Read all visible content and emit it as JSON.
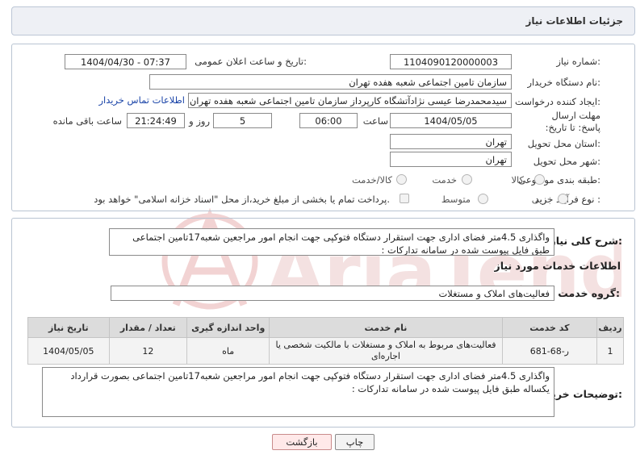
{
  "header": {
    "title": "جزئیات اطلاعات نیاز"
  },
  "form": {
    "need_number_label": "شماره نیاز:",
    "need_number": "1104090120000003",
    "announce_label": "تاریخ و ساعت اعلان عمومی:",
    "announce_value": "1404/04/30 - 07:37",
    "buyer_org_label": "نام دستگاه خریدار:",
    "buyer_org": "سازمان تامین اجتماعی شعبه هفده تهران",
    "creator_label": "ایجاد کننده درخواست:",
    "creator": "سیدمحمدرضا عیسی نژادآتشگاه کارپرداز سازمان تامین اجتماعی شعبه هفده تهران",
    "contact_link": "اطلاعات تماس خریدار",
    "deadline_label": "مهلت ارسال پاسخ: تا تاریخ:",
    "deadline_date": "1404/05/05",
    "hour_label": "ساعت",
    "deadline_time": "06:00",
    "days_value": "5",
    "days_label": "روز و",
    "remaining_time": "21:24:49",
    "remaining_label": "ساعت باقی مانده",
    "province_label": "استان محل تحویل:",
    "province": "تهران",
    "city_label": "شهر محل تحویل:",
    "city": "تهران",
    "category_label": "طبقه بندی موضوعی:",
    "category_options": [
      "کالا",
      "خدمت",
      "کالا/خدمت"
    ],
    "process_label": "نوع فرآیند خرید :",
    "process_options": [
      "جزیی",
      "متوسط"
    ],
    "payment_note": "پرداخت تمام یا بخشی از مبلغ خرید،از محل \"اسناد خزانه اسلامی\" خواهد بود."
  },
  "details": {
    "summary_label": "شرح کلی نیاز:",
    "summary_text": "واگذاری 4.5متر فضای اداری جهت استقرار دستگاه فتوکپی جهت انجام امور مراجعین شعبه17تامین اجتماعی طبق فایل پیوست شده در سامانه تدارکات :",
    "services_title": "اطلاعات خدمات مورد نیاز",
    "service_group_label": "گروه خدمت:",
    "service_group": "فعالیت‌های  املاک و مستغلات",
    "table": {
      "headers": [
        "ردیف",
        "کد خدمت",
        "نام خدمت",
        "واحد اندازه گیری",
        "تعداد / مقدار",
        "تاریخ نیاز"
      ],
      "rows": [
        [
          "1",
          "ر-68-681",
          "فعالیت‌های مربوط به املاک و مستغلات با مالکیت شخصی یا اجاره‌ای",
          "ماه",
          "12",
          "1404/05/05"
        ]
      ]
    },
    "buyer_notes_label": "توضیحات خریدار:",
    "buyer_notes_text": "واگذاری 4.5متر فضای اداری جهت استقرار دستگاه فتوکپی جهت انجام امور مراجعین شعبه17تامین اجتماعی بصورت قرارداد یکساله طبق فایل پیوست شده در سامانه تدارکات :"
  },
  "actions": {
    "print": "چاپ",
    "back": "بازگشت"
  },
  "watermark": {
    "text": "AriaTender.neT"
  }
}
